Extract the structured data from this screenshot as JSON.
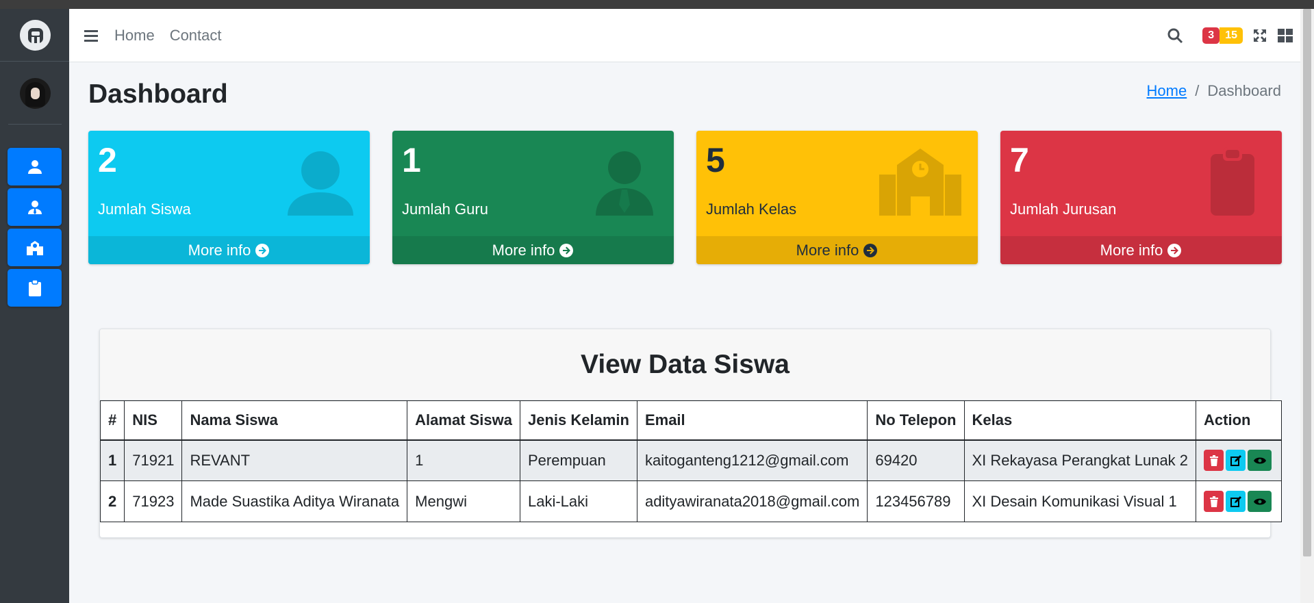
{
  "navbar": {
    "home": "Home",
    "contact": "Contact",
    "badge_red": "3",
    "badge_yellow": "15"
  },
  "header": {
    "title": "Dashboard",
    "breadcrumb_home": "Home",
    "breadcrumb_current": "Dashboard"
  },
  "stats": [
    {
      "count": "2",
      "label": "Jumlah Siswa",
      "more": "More info",
      "icon": "user-icon"
    },
    {
      "count": "1",
      "label": "Jumlah Guru",
      "more": "More info",
      "icon": "user-tie-icon"
    },
    {
      "count": "5",
      "label": "Jumlah Kelas",
      "more": "More info",
      "icon": "school-icon"
    },
    {
      "count": "7",
      "label": "Jumlah Jurusan",
      "more": "More info",
      "icon": "clipboard-icon"
    }
  ],
  "sidebar": {
    "items": [
      "user-icon",
      "user-tie-icon",
      "school-icon",
      "clipboard-icon"
    ]
  },
  "table": {
    "title": "View Data Siswa",
    "columns": [
      "#",
      "NIS",
      "Nama Siswa",
      "Alamat Siswa",
      "Jenis Kelamin",
      "Email",
      "No Telepon",
      "Kelas",
      "Action"
    ],
    "rows": [
      [
        "1",
        "71921",
        "REVANT",
        "1",
        "Perempuan",
        "kaitoganteng1212@gmail.com",
        "69420",
        "XI Rekayasa Perangkat Lunak 2"
      ],
      [
        "2",
        "71923",
        "Made Suastika Aditya Wiranata",
        "Mengwi",
        "Laki-Laki",
        "adityawiranata2018@gmail.com",
        "123456789",
        "XI Desain Komunikasi Visual 1"
      ]
    ]
  },
  "colors": {
    "primary": "#007bff",
    "info": "#0dcaf0",
    "success": "#198754",
    "warning": "#ffc107",
    "danger": "#dc3545",
    "sidebar": "#343a40"
  }
}
